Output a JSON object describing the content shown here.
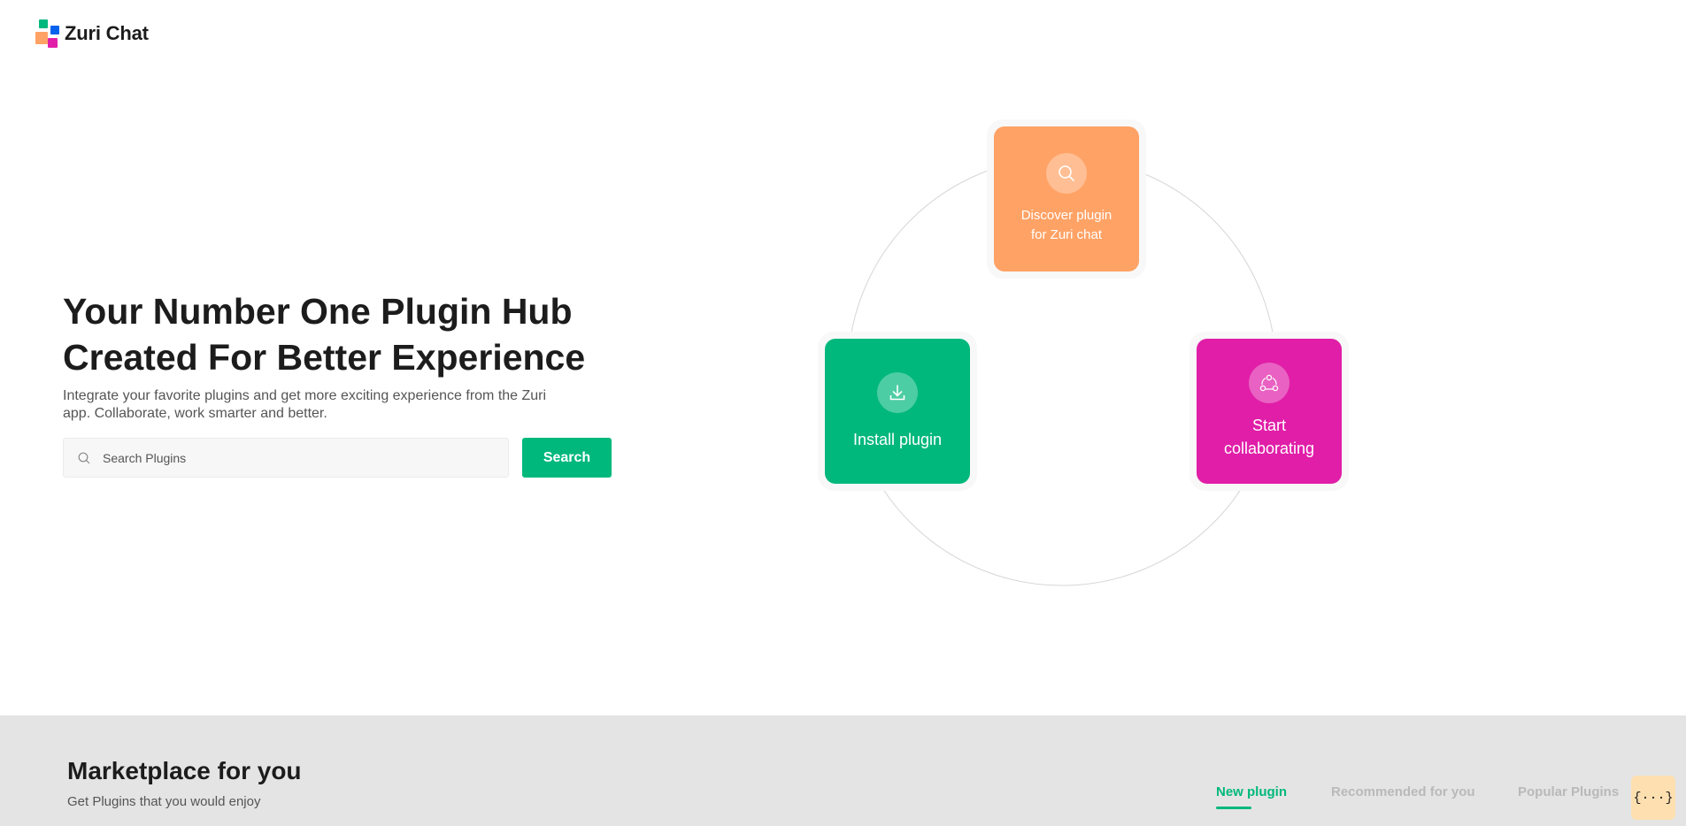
{
  "brand": {
    "name": "Zuri Chat"
  },
  "hero": {
    "title": "Your Number One Plugin Hub Created For Better Experience",
    "subtitle": "Integrate your favorite plugins and get more exciting experience from the Zuri app. Collaborate, work smarter and better.",
    "search_placeholder": "Search Plugins",
    "search_button": "Search"
  },
  "steps": {
    "discover": {
      "label": "Discover plugin for Zuri chat",
      "icon": "search-icon",
      "color": "#ffa265"
    },
    "install": {
      "label": "Install plugin",
      "icon": "download-icon",
      "color": "#00b87c"
    },
    "collaborate": {
      "label": "Start collaborating",
      "icon": "collaboration-icon",
      "color": "#e01ea8"
    }
  },
  "marketplace": {
    "title": "Marketplace for you",
    "subtitle": "Get Plugins that you would enjoy",
    "tabs": [
      {
        "label": "New plugin",
        "active": true
      },
      {
        "label": "Recommended for you",
        "active": false
      },
      {
        "label": "Popular Plugins",
        "active": false
      }
    ],
    "dev_button": "{···}"
  },
  "colors": {
    "accent": "#00b87c",
    "orange": "#ffa265",
    "pink": "#e01ea8",
    "blue": "#0562ed"
  }
}
